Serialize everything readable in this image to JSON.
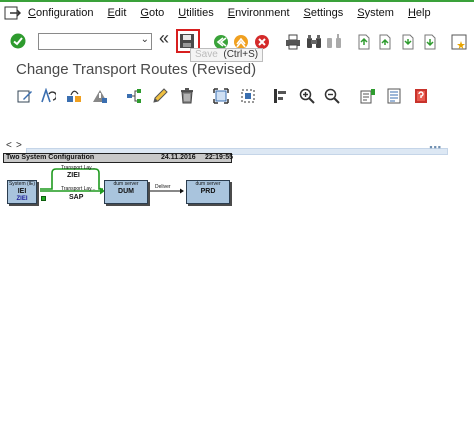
{
  "menu": {
    "items": [
      {
        "first": "C",
        "rest": "onfiguration"
      },
      {
        "first": "E",
        "rest": "dit"
      },
      {
        "first": "G",
        "rest": "oto"
      },
      {
        "first": "U",
        "rest": "tilities"
      },
      {
        "first": "E",
        "rest": "nvironment"
      },
      {
        "first": "S",
        "rest": "ettings"
      },
      {
        "first": "S",
        "rest": "ystem"
      },
      {
        "first": "H",
        "rest": "elp"
      }
    ]
  },
  "toolbar": {
    "command_value": "",
    "dropdown_glyph": "⌄",
    "back_glyph": "«",
    "tooltip_prefix": "Save",
    "tooltip_text": "(Ctrl+S)"
  },
  "page": {
    "title": "Change Transport Routes (Revised)"
  },
  "scroll": {
    "left": "<",
    "right": ">",
    "grip": "▪▪▪"
  },
  "diagram": {
    "header_title": "Two System Configuration",
    "header_date": "24.11.2016",
    "header_time": "22:19:55",
    "systems": {
      "iei_sub": "System (IE)",
      "iei_name": "IEI",
      "iei_client": "ZIEI",
      "zi_sub": "Transport Lay...",
      "zi_name": "ZIEI",
      "sap_sub": "Transport Lay...",
      "sap_name": "SAP",
      "dum_sub": "dum server",
      "dum_name": "DUM",
      "prd_sub": "dum server",
      "prd_name": "PRD",
      "del_label": "Deliver"
    }
  },
  "colors": {
    "system_box": "#a9c4dd",
    "route_green": "#1f9a1f",
    "save_highlight": "#d71f1f",
    "title_text": "#4a4a4a"
  }
}
